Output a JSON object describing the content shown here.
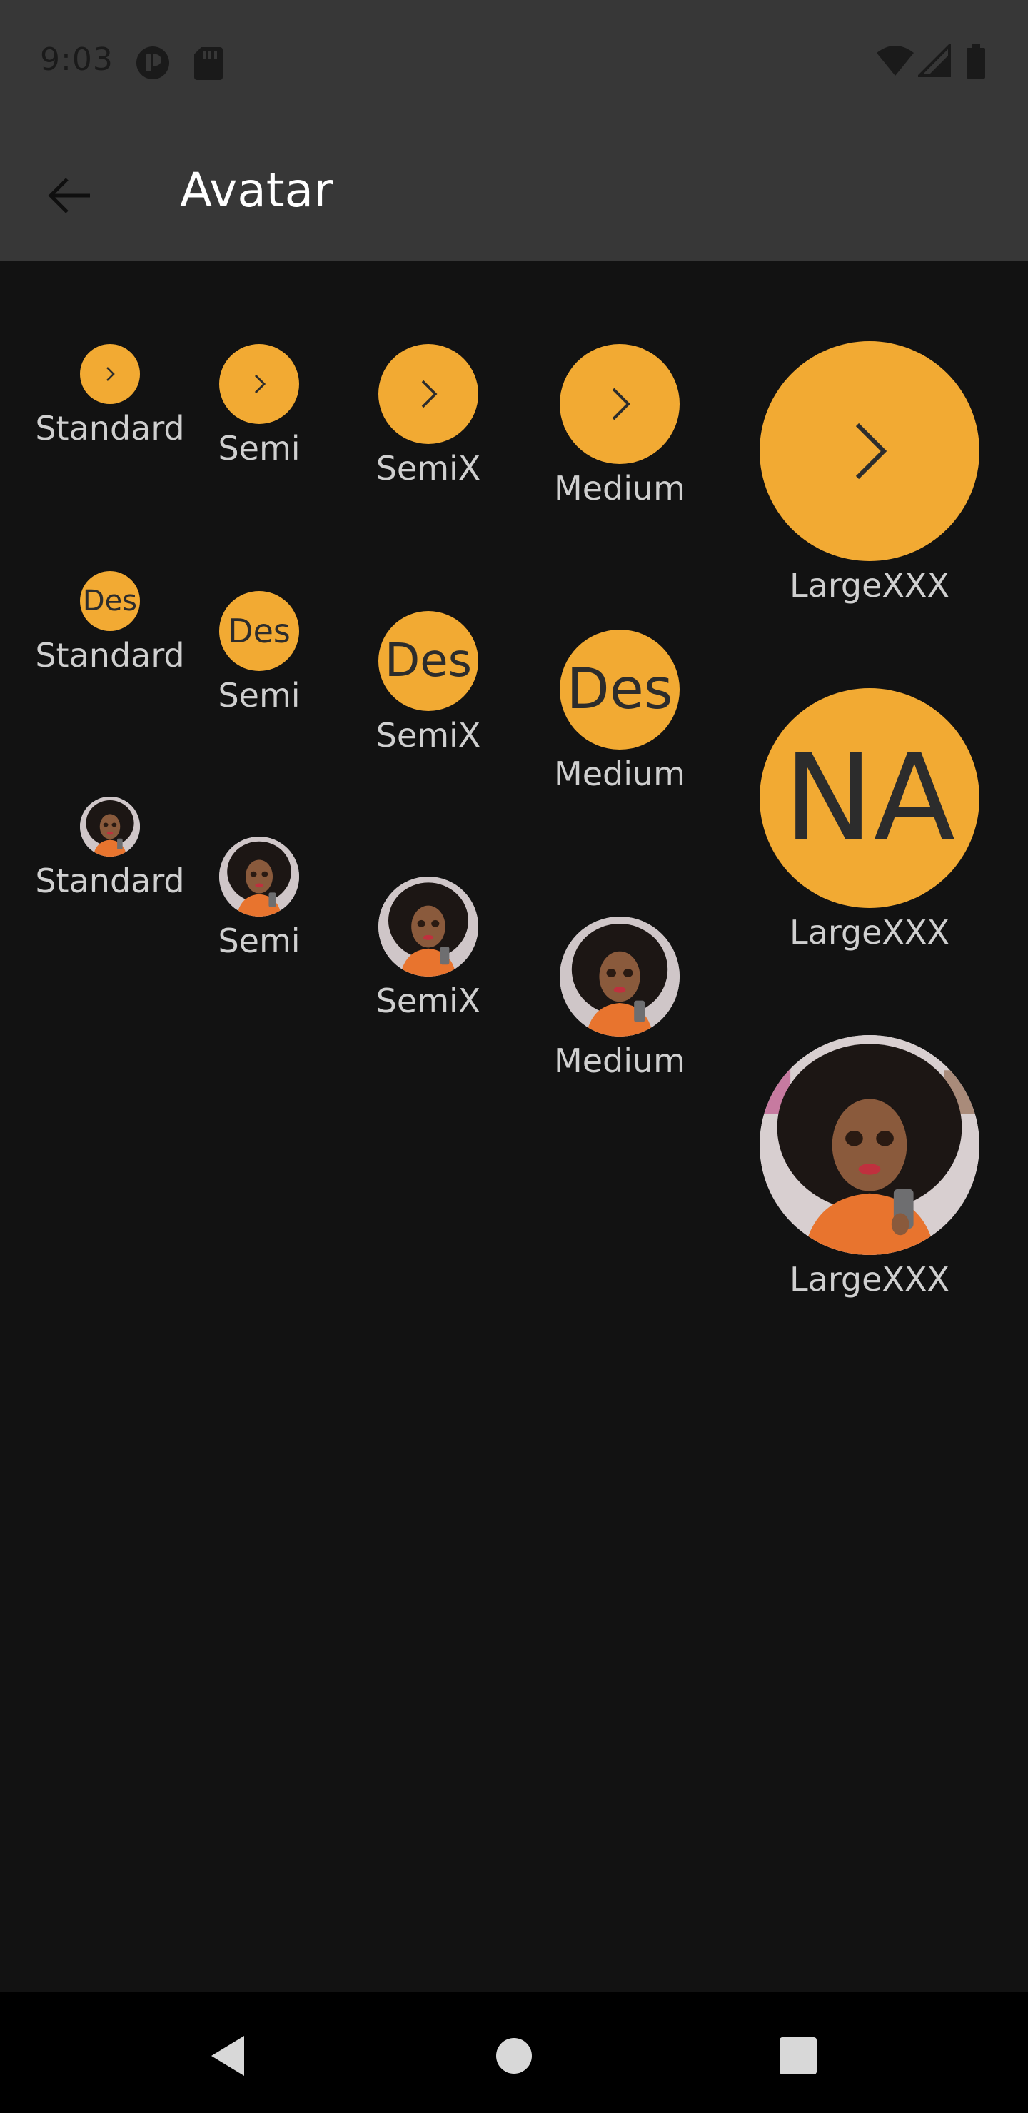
{
  "status_bar": {
    "time": "9:03",
    "left_icons": [
      "app-notification-icon",
      "sd-card-icon"
    ],
    "right_icons": [
      "wifi-icon",
      "cell-signal-icon",
      "battery-icon"
    ]
  },
  "app_bar": {
    "title": "Avatar",
    "back_icon": "arrow-back-icon"
  },
  "colors": {
    "accent": "#f2aa33",
    "background": "#121212",
    "appbar": "#373737",
    "label": "#cfcfcf"
  },
  "rows": {
    "icon_row": {
      "content": "chevron-right-icon",
      "labels": [
        "Standard",
        "Semi",
        "SemiX",
        "Medium",
        "LargeXXX"
      ]
    },
    "initials_row": {
      "initials": [
        "Des",
        "Des",
        "Des",
        "Des",
        "NA"
      ],
      "labels": [
        "Standard",
        "Semi",
        "SemiX",
        "Medium",
        "LargeXXX"
      ]
    },
    "image_row": {
      "content": "profile-photo",
      "labels": [
        "Standard",
        "Semi",
        "SemiX",
        "Medium",
        "LargeXXX"
      ]
    }
  },
  "nav_bar": {
    "icons": [
      "nav-back-icon",
      "nav-home-icon",
      "nav-recents-icon"
    ]
  }
}
